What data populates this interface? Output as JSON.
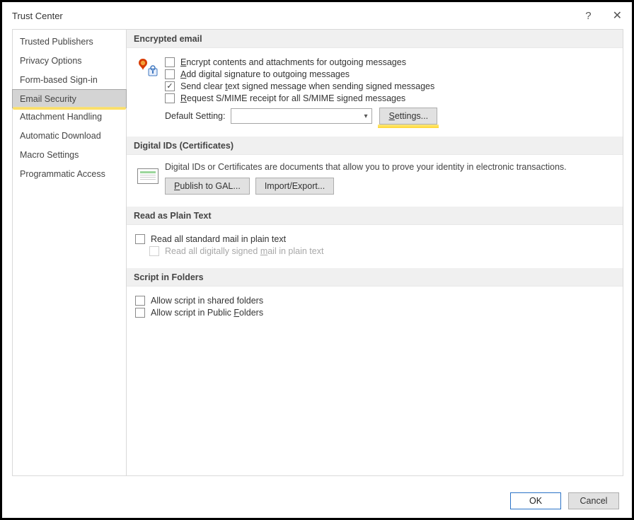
{
  "title": "Trust Center",
  "sidebar": {
    "items": [
      {
        "label": "Trusted Publishers"
      },
      {
        "label": "Privacy Options"
      },
      {
        "label": "Form-based Sign-in"
      },
      {
        "label": "Email Security",
        "selected": true,
        "highlighted": true
      },
      {
        "label": "Attachment Handling"
      },
      {
        "label": "Automatic Download"
      },
      {
        "label": "Macro Settings"
      },
      {
        "label": "Programmatic Access"
      }
    ]
  },
  "sections": {
    "encrypted": {
      "header": "Encrypted email",
      "encrypt_label": "Encrypt contents and attachments for outgoing messages",
      "encrypt_checked": false,
      "addsig_label": "Add digital signature to outgoing messages",
      "addsig_checked": false,
      "cleartext_label_pre": "Send clear ",
      "cleartext_label_u": "t",
      "cleartext_label_post": "ext signed message when sending signed messages",
      "cleartext_checked": true,
      "request_label_pre": "",
      "request_label_u": "R",
      "request_label_post": "equest S/MIME receipt for all S/MIME signed messages",
      "request_checked": false,
      "default_label": "Default Setting:",
      "settings_btn_pre": "",
      "settings_btn_u": "S",
      "settings_btn_post": "ettings...",
      "settings_highlighted": true
    },
    "digitalids": {
      "header": "Digital IDs (Certificates)",
      "desc": "Digital IDs or Certificates are documents that allow you to prove your identity in electronic transactions.",
      "publish_btn_u": "P",
      "publish_btn_post": "ublish to GAL...",
      "import_btn": "Import/Export..."
    },
    "plaintext": {
      "header": "Read as Plain Text",
      "read_all_label": "Read all standard mail in plain text",
      "read_all_checked": false,
      "read_signed_pre": "Read all digitally signed ",
      "read_signed_u": "m",
      "read_signed_post": "ail in plain text",
      "read_signed_checked": false,
      "read_signed_disabled": true
    },
    "script": {
      "header": "Script in Folders",
      "shared_label": "Allow script in shared folders",
      "shared_checked": false,
      "public_pre": "Allow script in Public ",
      "public_u": "F",
      "public_post": "olders",
      "public_checked": false
    }
  },
  "footer": {
    "ok": "OK",
    "cancel": "Cancel"
  }
}
